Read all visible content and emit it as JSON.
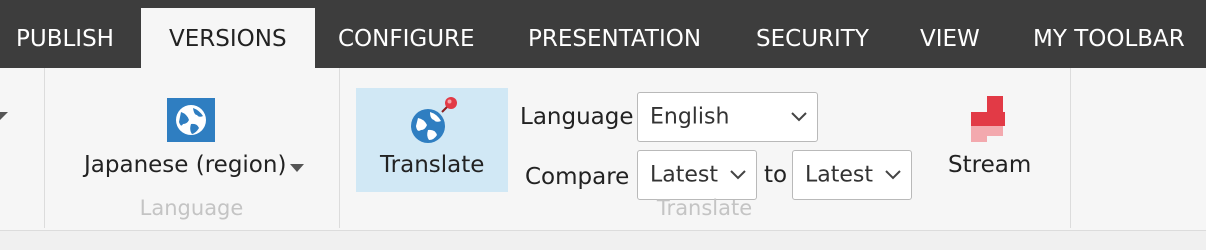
{
  "tabs": [
    {
      "label": "PUBLISH"
    },
    {
      "label": "VERSIONS"
    },
    {
      "label": "CONFIGURE"
    },
    {
      "label": "PRESENTATION"
    },
    {
      "label": "SECURITY"
    },
    {
      "label": "VIEW"
    },
    {
      "label": "MY TOOLBAR"
    }
  ],
  "active_tab": "VERSIONS",
  "language_group": {
    "icon": "globe-icon",
    "selector_label": "Japanese (region)",
    "group_label": "Language"
  },
  "translate_group": {
    "translate_button": "Translate",
    "translate_icon": "globe-translate-icon",
    "language_label": "Language",
    "language_value": "English",
    "compare_label": "Compare",
    "compare_from": "Latest",
    "to_label": "to",
    "compare_to": "Latest",
    "group_label": "Translate"
  },
  "stream": {
    "label": "Stream",
    "icon": "stream-icon"
  },
  "colors": {
    "tabbar": "#3d3d3d",
    "ribbon": "#f6f6f6",
    "translate_highlight": "#d1e8f5",
    "globe_blue": "#2f7ec1",
    "stream_red": "#e23a46"
  }
}
